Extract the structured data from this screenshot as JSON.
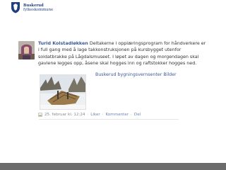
{
  "header": {
    "logo_line1": "Buskerud",
    "logo_line2": "fylkeskommune"
  },
  "post": {
    "author": "Turid Kolstadløkken",
    "text": "Deltakerne i opplæringsprogram for håndverkere er i full gang med å lage takkonstruksjonen på kursbygget utenfor soldatbrakke på Lågdalsmuseet. I løpet av dagen og morgendagen skal gavlene legges opp, åsene skal hogges inn og raftstokker hogges ned.",
    "attachment": {
      "title": "Buskerud bygningsvernsenter Bilder"
    },
    "meta": {
      "timestamp": "25. februar kl. 12:24",
      "sep": "·",
      "like": "Liker",
      "comment": "Kommenter",
      "share": "Del"
    }
  },
  "colors": {
    "link": "#3b5998",
    "footer": "#6b6b6b",
    "logo": "#1f3f7f"
  }
}
